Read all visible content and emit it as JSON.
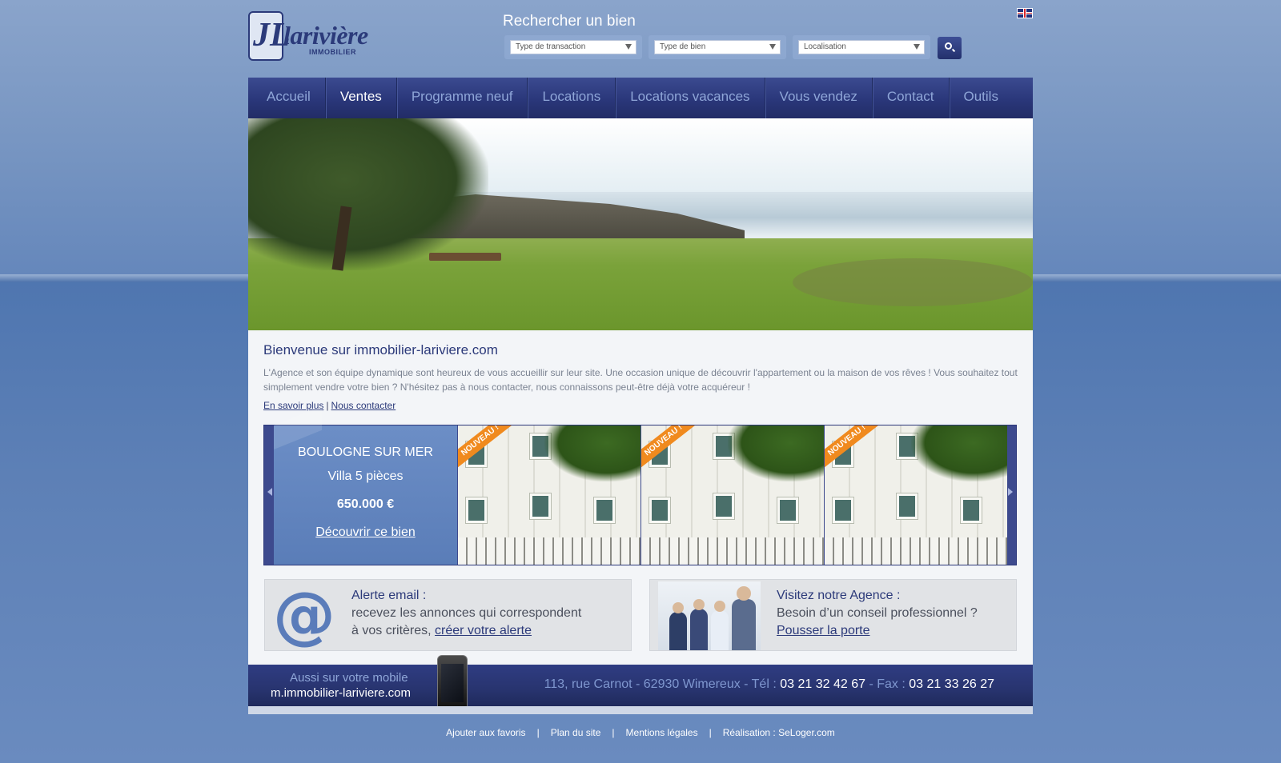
{
  "search": {
    "title": "Rechercher un bien",
    "transaction_placeholder": "Type de transaction",
    "property_type_placeholder": "Type de bien",
    "location_placeholder": "Localisation"
  },
  "icons": {
    "search": "search-icon",
    "flag": "uk-flag-icon",
    "email": "at-icon"
  },
  "nav": {
    "items": [
      {
        "label": "Accueil",
        "active": false
      },
      {
        "label": "Ventes",
        "active": true
      },
      {
        "label": "Programme neuf",
        "active": false
      },
      {
        "label": "Locations",
        "active": false
      },
      {
        "label": "Locations vacances",
        "active": false
      },
      {
        "label": "Vous vendez",
        "active": false
      },
      {
        "label": "Contact",
        "active": false
      },
      {
        "label": "Outils",
        "active": false
      }
    ]
  },
  "welcome": {
    "title": "Bienvenue sur immobilier-lariviere.com",
    "text": "L'Agence et son équipe dynamique sont heureux de vous accueillir sur leur site. Une occasion unique de découvrir l'appartement ou la maison de vos rêves ! Vous souhaitez tout simplement vendre votre bien ? N'hésitez pas à nous contacter, nous connaissons peut-être déjà votre acquéreur !",
    "link_more": "En savoir plus",
    "link_separator": "|",
    "link_contact": "Nous contacter"
  },
  "featured": {
    "city": "BOULOGNE SUR MER",
    "type": "Villa 5 pièces",
    "price": "650.000 €",
    "cta": "Découvrir ce bien",
    "badge": "NOUVEAU !"
  },
  "alert": {
    "title": "Alerte email :",
    "line1": "recevez les annonces qui correspondent",
    "line2": "à vos critères,",
    "link": "créer votre alerte"
  },
  "agency": {
    "title": "Visitez notre Agence :",
    "line1": "Besoin d’un conseil professionnel ?",
    "link": "Pousser la porte"
  },
  "footer": {
    "mobile_label": "Aussi sur votre  mobile",
    "mobile_url": "m.immobilier-lariviere.com",
    "address": "113, rue Carnot - 62930 Wimereux - Tél :",
    "phone": "03 21 32 42 67",
    "fax_label": "- Fax :",
    "fax": "03 21 33 26 27",
    "links": [
      "Ajouter aux favoris",
      "Plan du site",
      "Mentions légales",
      "Réalisation : SeLoger.com"
    ],
    "separator": "|"
  },
  "logo": {
    "monogram": "JL",
    "name": "larivière",
    "sub": "IMMOBILIER"
  },
  "colors": {
    "brand": "#2b3a7a",
    "nav_bg": "#2a377a",
    "accent_orange": "#f08a1e",
    "background": "#6788bd"
  }
}
